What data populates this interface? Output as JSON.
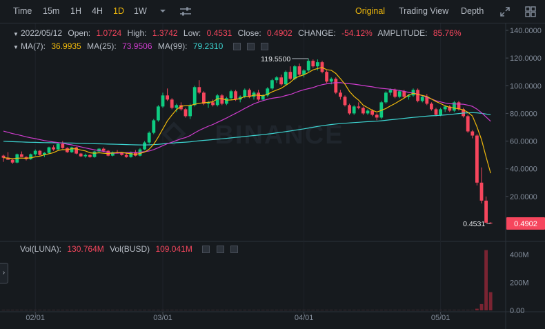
{
  "toolbar": {
    "intervals": [
      "Time",
      "15m",
      "1H",
      "4H",
      "1D",
      "1W"
    ],
    "active_interval": "1D",
    "views": [
      "Original",
      "Trading View",
      "Depth"
    ],
    "active_view": "Original"
  },
  "ohlc": {
    "date": "2022/05/12",
    "open_label": "Open:",
    "open": "1.0724",
    "high_label": "High:",
    "high": "1.3742",
    "low_label": "Low:",
    "low": "0.4531",
    "close_label": "Close:",
    "close": "0.4902",
    "change_label": "CHANGE:",
    "change": "-54.12%",
    "amplitude_label": "AMPLITUDE:",
    "amplitude": "85.76%"
  },
  "ma_legend": {
    "ma7_label": "MA(7):",
    "ma7": "36.9935",
    "ma25_label": "MA(25):",
    "ma25": "73.9506",
    "ma99_label": "MA(99):",
    "ma99": "79.2310"
  },
  "vol_legend": {
    "luna_label": "Vol(LUNA):",
    "luna": "130.764M",
    "busd_label": "Vol(BUSD)",
    "busd": "109.041M"
  },
  "watermark": "BINANCE",
  "colors": {
    "up": "#0ecb81",
    "down": "#f6465d",
    "ma7": "#f0b90b",
    "ma25": "#d03ccf",
    "ma99": "#3dd5d2",
    "bg": "#161a1e"
  },
  "chart_data": {
    "type": "candlestick",
    "price_axis": {
      "ylim": [
        0,
        140
      ],
      "ticks": [
        "0.0000",
        "20.0000",
        "40.0000",
        "60.0000",
        "80.0000",
        "100.0000",
        "120.0000",
        "140.0000"
      ],
      "side": "right"
    },
    "volume_axis": {
      "ylim": [
        0,
        450
      ],
      "ticks": [
        "0.00",
        "200M",
        "400M"
      ],
      "side": "right"
    },
    "x_ticks": [
      "02/01",
      "03/01",
      "04/01",
      "05/01"
    ],
    "high_marker": "119.5500",
    "low_marker": "0.4531",
    "last_price": "0.4902",
    "candles": [
      [
        "2022-01-25",
        49.5,
        50.2,
        45.0,
        48.0
      ],
      [
        "2022-01-26",
        48.0,
        52.0,
        47.0,
        46.5
      ],
      [
        "2022-01-27",
        46.5,
        47.5,
        43.5,
        44.5
      ],
      [
        "2022-01-28",
        44.5,
        51.0,
        44.0,
        50.5
      ],
      [
        "2022-01-29",
        50.5,
        52.5,
        48.5,
        48.5
      ],
      [
        "2022-01-30",
        48.5,
        49.0,
        46.0,
        47.0
      ],
      [
        "2022-01-31",
        47.0,
        51.0,
        46.5,
        50.5
      ],
      [
        "2022-02-01",
        50.5,
        54.0,
        49.5,
        53.0
      ],
      [
        "2022-02-02",
        53.0,
        53.5,
        49.5,
        50.0
      ],
      [
        "2022-02-03",
        50.0,
        52.0,
        48.5,
        51.5
      ],
      [
        "2022-02-04",
        51.5,
        56.0,
        51.0,
        55.5
      ],
      [
        "2022-02-05",
        55.5,
        57.0,
        53.0,
        54.0
      ],
      [
        "2022-02-06",
        54.0,
        58.5,
        53.5,
        58.0
      ],
      [
        "2022-02-07",
        58.0,
        60.0,
        54.5,
        55.0
      ],
      [
        "2022-02-08",
        55.0,
        55.5,
        51.5,
        52.0
      ],
      [
        "2022-02-09",
        52.0,
        56.0,
        51.5,
        55.5
      ],
      [
        "2022-02-10",
        55.5,
        56.0,
        50.5,
        51.0
      ],
      [
        "2022-02-11",
        51.0,
        51.5,
        48.5,
        49.0
      ],
      [
        "2022-02-12",
        49.0,
        51.0,
        48.0,
        50.0
      ],
      [
        "2022-02-13",
        50.0,
        50.5,
        48.0,
        48.5
      ],
      [
        "2022-02-14",
        48.5,
        53.0,
        48.0,
        52.5
      ],
      [
        "2022-02-15",
        52.5,
        55.0,
        52.0,
        54.5
      ],
      [
        "2022-02-16",
        54.5,
        55.5,
        52.0,
        53.0
      ],
      [
        "2022-02-17",
        53.0,
        53.5,
        49.0,
        49.5
      ],
      [
        "2022-02-18",
        49.5,
        52.5,
        49.0,
        52.0
      ],
      [
        "2022-02-19",
        52.0,
        53.5,
        51.0,
        51.5
      ],
      [
        "2022-02-20",
        51.5,
        52.0,
        49.5,
        50.0
      ],
      [
        "2022-02-21",
        50.0,
        51.0,
        48.0,
        48.5
      ],
      [
        "2022-02-22",
        48.5,
        52.5,
        48.0,
        52.0
      ],
      [
        "2022-02-23",
        52.0,
        53.5,
        49.0,
        49.5
      ],
      [
        "2022-02-24",
        49.5,
        55.0,
        49.0,
        54.0
      ],
      [
        "2022-02-25",
        54.0,
        60.0,
        53.5,
        59.0
      ],
      [
        "2022-02-26",
        59.0,
        67.0,
        58.0,
        66.0
      ],
      [
        "2022-02-27",
        66.0,
        76.0,
        65.0,
        75.0
      ],
      [
        "2022-02-28",
        75.0,
        86.0,
        74.0,
        85.0
      ],
      [
        "2022-03-01",
        85.0,
        95.0,
        84.0,
        93.0
      ],
      [
        "2022-03-02",
        93.0,
        98.0,
        89.0,
        90.0
      ],
      [
        "2022-03-03",
        90.0,
        91.0,
        83.0,
        84.0
      ],
      [
        "2022-03-04",
        84.0,
        87.0,
        81.0,
        86.0
      ],
      [
        "2022-03-05",
        86.0,
        88.0,
        82.0,
        83.0
      ],
      [
        "2022-03-06",
        83.0,
        84.0,
        77.0,
        78.0
      ],
      [
        "2022-03-07",
        78.0,
        87.0,
        76.0,
        86.0
      ],
      [
        "2022-03-08",
        86.0,
        100.0,
        85.0,
        99.0
      ],
      [
        "2022-03-09",
        99.0,
        104.0,
        94.0,
        95.0
      ],
      [
        "2022-03-10",
        95.0,
        96.0,
        86.0,
        87.0
      ],
      [
        "2022-03-11",
        87.0,
        89.0,
        84.0,
        88.0
      ],
      [
        "2022-03-12",
        88.0,
        90.0,
        85.0,
        86.0
      ],
      [
        "2022-03-13",
        86.0,
        94.0,
        85.0,
        93.0
      ],
      [
        "2022-03-14",
        93.0,
        94.0,
        86.0,
        87.0
      ],
      [
        "2022-03-15",
        87.0,
        92.0,
        86.0,
        91.0
      ],
      [
        "2022-03-16",
        91.0,
        97.0,
        90.0,
        96.0
      ],
      [
        "2022-03-17",
        96.0,
        97.0,
        89.0,
        90.0
      ],
      [
        "2022-03-18",
        90.0,
        93.0,
        88.0,
        92.0
      ],
      [
        "2022-03-19",
        92.0,
        98.0,
        91.0,
        97.0
      ],
      [
        "2022-03-20",
        97.0,
        98.0,
        91.0,
        92.0
      ],
      [
        "2022-03-21",
        92.0,
        96.0,
        90.0,
        95.0
      ],
      [
        "2022-03-22",
        95.0,
        97.0,
        89.0,
        90.0
      ],
      [
        "2022-03-23",
        90.0,
        94.0,
        89.0,
        93.0
      ],
      [
        "2022-03-24",
        93.0,
        99.0,
        92.0,
        98.0
      ],
      [
        "2022-03-25",
        98.0,
        105.0,
        97.0,
        104.0
      ],
      [
        "2022-03-26",
        104.0,
        107.0,
        102.0,
        106.0
      ],
      [
        "2022-03-27",
        106.0,
        108.0,
        100.0,
        101.0
      ],
      [
        "2022-03-28",
        101.0,
        111.0,
        100.0,
        110.0
      ],
      [
        "2022-03-29",
        110.0,
        114.0,
        104.0,
        105.0
      ],
      [
        "2022-03-30",
        105.0,
        115.0,
        104.0,
        114.0
      ],
      [
        "2022-03-31",
        114.0,
        116.0,
        107.0,
        108.0
      ],
      [
        "2022-04-01",
        108.0,
        112.0,
        106.0,
        111.0
      ],
      [
        "2022-04-02",
        111.0,
        119.55,
        110.0,
        118.0
      ],
      [
        "2022-04-03",
        118.0,
        119.0,
        113.0,
        114.0
      ],
      [
        "2022-04-04",
        114.0,
        119.0,
        111.0,
        117.0
      ],
      [
        "2022-04-05",
        117.0,
        118.0,
        109.0,
        110.0
      ],
      [
        "2022-04-06",
        110.0,
        111.0,
        102.0,
        103.0
      ],
      [
        "2022-04-07",
        103.0,
        106.0,
        101.0,
        105.0
      ],
      [
        "2022-04-08",
        105.0,
        106.0,
        94.0,
        95.0
      ],
      [
        "2022-04-09",
        95.0,
        97.0,
        90.0,
        92.0
      ],
      [
        "2022-04-10",
        92.0,
        93.0,
        85.0,
        86.0
      ],
      [
        "2022-04-11",
        86.0,
        87.0,
        79.0,
        80.0
      ],
      [
        "2022-04-12",
        80.0,
        86.0,
        79.0,
        85.0
      ],
      [
        "2022-04-13",
        85.0,
        88.0,
        83.0,
        84.0
      ],
      [
        "2022-04-14",
        84.0,
        85.0,
        79.0,
        80.0
      ],
      [
        "2022-04-15",
        80.0,
        83.0,
        79.0,
        82.0
      ],
      [
        "2022-04-16",
        82.0,
        83.0,
        78.0,
        79.0
      ],
      [
        "2022-04-17",
        79.0,
        80.0,
        75.0,
        77.0
      ],
      [
        "2022-04-18",
        77.0,
        89.0,
        76.0,
        88.0
      ],
      [
        "2022-04-19",
        88.0,
        96.0,
        87.0,
        95.0
      ],
      [
        "2022-04-20",
        95.0,
        98.0,
        93.0,
        97.0
      ],
      [
        "2022-04-21",
        97.0,
        98.0,
        91.0,
        92.0
      ],
      [
        "2022-04-22",
        92.0,
        97.0,
        91.0,
        96.0
      ],
      [
        "2022-04-23",
        96.0,
        97.0,
        91.0,
        92.0
      ],
      [
        "2022-04-24",
        92.0,
        94.0,
        90.0,
        93.0
      ],
      [
        "2022-04-25",
        93.0,
        98.0,
        92.0,
        97.0
      ],
      [
        "2022-04-26",
        97.0,
        98.0,
        88.0,
        89.0
      ],
      [
        "2022-04-27",
        89.0,
        93.0,
        88.0,
        92.0
      ],
      [
        "2022-04-28",
        92.0,
        94.0,
        86.0,
        87.0
      ],
      [
        "2022-04-29",
        87.0,
        88.0,
        82.0,
        83.0
      ],
      [
        "2022-04-30",
        83.0,
        84.0,
        78.0,
        79.0
      ],
      [
        "2022-05-01",
        79.0,
        84.0,
        78.0,
        83.0
      ],
      [
        "2022-05-02",
        83.0,
        86.0,
        81.0,
        85.0
      ],
      [
        "2022-05-03",
        85.0,
        86.0,
        81.0,
        82.0
      ],
      [
        "2022-05-04",
        82.0,
        89.0,
        81.0,
        88.0
      ],
      [
        "2022-05-05",
        88.0,
        89.0,
        82.0,
        83.0
      ],
      [
        "2022-05-06",
        83.0,
        84.0,
        77.0,
        78.0
      ],
      [
        "2022-05-07",
        78.0,
        79.0,
        66.0,
        67.0
      ],
      [
        "2022-05-08",
        67.0,
        68.0,
        62.0,
        64.0
      ],
      [
        "2022-05-09",
        64.0,
        65.0,
        28.0,
        30.0
      ],
      [
        "2022-05-10",
        30.0,
        41.0,
        15.0,
        17.0
      ],
      [
        "2022-05-11",
        17.0,
        20.0,
        1.0,
        1.07
      ],
      [
        "2022-05-12",
        1.0724,
        1.3742,
        0.4531,
        0.4902
      ]
    ],
    "volume": [
      [
        "2022-05-09",
        12
      ],
      [
        "2022-05-10",
        45
      ],
      [
        "2022-05-11",
        432
      ],
      [
        "2022-05-12",
        130.764
      ]
    ]
  }
}
